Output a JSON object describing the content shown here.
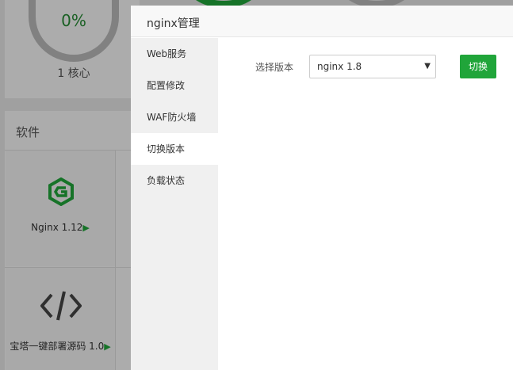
{
  "background": {
    "gauge": {
      "value": "0%",
      "label": "1 核心"
    },
    "section_title": "软件",
    "software": [
      {
        "name": "Nginx 1.12",
        "icon": "nginx-logo-icon"
      },
      {
        "name": "宝塔一键部署源码 1.0",
        "icon": "code-brackets-icon"
      }
    ]
  },
  "modal": {
    "title": "nginx管理",
    "menu": [
      {
        "label": "Web服务"
      },
      {
        "label": "配置修改"
      },
      {
        "label": "WAF防火墙"
      },
      {
        "label": "切换版本",
        "active": true
      },
      {
        "label": "负载状态"
      }
    ],
    "field_label": "选择版本",
    "select_value": "nginx 1.8",
    "button_label": "切换"
  },
  "colors": {
    "accent": "#20a53a",
    "gauge_text": "#258a33"
  }
}
